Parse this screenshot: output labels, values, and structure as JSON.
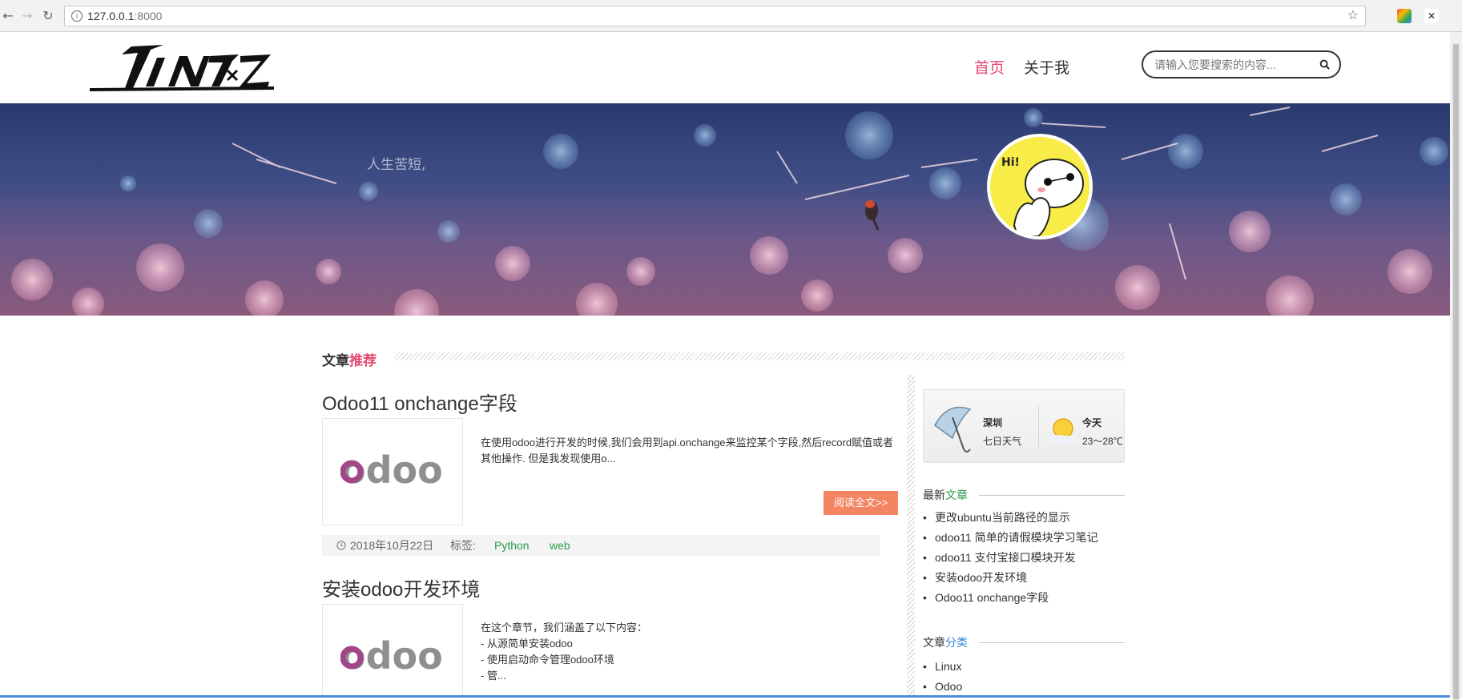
{
  "browser": {
    "url_host": "127.0.0.1",
    "url_port": ":8000"
  },
  "header": {
    "logo_alt": "PINZ",
    "nav": [
      {
        "label": "首页"
      },
      {
        "label": "关于我"
      }
    ],
    "search_placeholder": "请输入您要搜索的内容..."
  },
  "banner": {
    "motto": "人生苦短,"
  },
  "main": {
    "section_title_a": "文章",
    "section_title_b": "推荐",
    "posts": [
      {
        "title": "Odoo11 onchange字段",
        "excerpt": " 在使用odoo进行开发的时候,我们会用到api.onchange来监控某个字段,然后record赋值或者其他操作. 但是我发现使用o...",
        "read_more": "阅读全文>>",
        "date": "2018年10月22日",
        "tag_label": "标签:",
        "tags": [
          "Python",
          "web"
        ]
      },
      {
        "title": "安装odoo开发环境",
        "excerpt": "在这个章节，我们涵盖了以下内容：\n- 从源简单安装odoo\n- 使用启动命令管理odoo环境\n- 管..."
      }
    ],
    "thumb_text": "odoo"
  },
  "sidebar": {
    "weather": {
      "city": "深圳",
      "week": "七日天气",
      "today": "今天",
      "temp": "23～28℃"
    },
    "latest_title_a": "最新",
    "latest_title_b": "文章",
    "latest": [
      "更改ubuntu当前路径的显示",
      "odoo11 简单的请假模块学习笔记",
      "odoo11 支付宝接口模块开发",
      "安装odoo开发环境",
      "Odoo11 onchange字段"
    ],
    "category_title_a": "文章",
    "category_title_b": "分类",
    "categories": [
      "Linux",
      "Odoo"
    ]
  },
  "colors": {
    "accent_pink": "#e5476e",
    "button_orange": "#f48562",
    "tag_green": "#2a9a4a"
  }
}
